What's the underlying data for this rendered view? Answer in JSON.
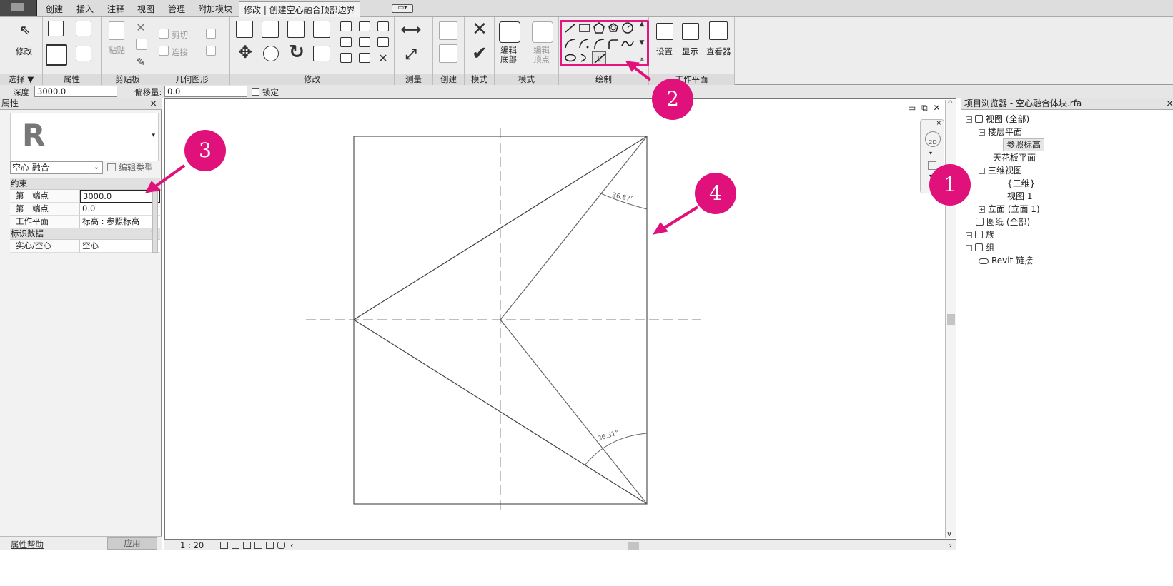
{
  "menu": {
    "tabs": [
      "创建",
      "插入",
      "注释",
      "视图",
      "管理",
      "附加模块"
    ],
    "active_tab": "修改 | 创建空心融合顶部边界"
  },
  "ribbon": {
    "select": {
      "tool": "修改",
      "panel": "选择 ▼"
    },
    "properties_panel": "属性",
    "clipboard": {
      "paste": "粘贴",
      "panel": "剪贴板"
    },
    "geometry": {
      "cut": "剪切",
      "join": "连接",
      "panel": "几何图形"
    },
    "modify": {
      "panel": "修改"
    },
    "measure": {
      "panel": "测量"
    },
    "create": {
      "panel": "创建"
    },
    "mode": {
      "panel": "模式"
    },
    "mode2": {
      "edit_bottom": "编辑底部",
      "edit_vertex": "编辑顶点",
      "panel": "模式"
    },
    "draw": {
      "panel": "绘制"
    },
    "workplane": {
      "set": "设置",
      "show": "显示",
      "viewer": "查看器",
      "panel": "工作平面"
    }
  },
  "options": {
    "depth_label": "深度",
    "depth_value": "3000.0",
    "offset_label": "偏移量:",
    "offset_value": "0.0",
    "lock_label": "锁定"
  },
  "properties": {
    "title": "属性",
    "type": "空心 融合",
    "edit_type": "编辑类型",
    "constraints": "约束",
    "second_end_label": "第二端点",
    "second_end_value": "3000.0",
    "first_end_label": "第一端点",
    "first_end_value": "0.0",
    "workplane_label": "工作平面",
    "workplane_value": "标高 : 参照标高",
    "identity": "标识数据",
    "solid_void_label": "实心/空心",
    "solid_void_value": "空心",
    "help": "属性帮助",
    "apply": "应用"
  },
  "canvas": {
    "angle_top": "36.87°",
    "angle_bottom": "36.31°",
    "scale": "1 : 20"
  },
  "browser": {
    "title": "项目浏览器 - 空心融合体块.rfa",
    "views": "视图 (全部)",
    "floor_plans": "楼层平面",
    "ref_level": "参照标高",
    "ceiling": "天花板平面",
    "three_d": "三维视图",
    "three_d_item": "{三维}",
    "view1": "视图 1",
    "elevation": "立面 (立面 1)",
    "sheets": "图纸 (全部)",
    "families": "族",
    "groups": "组",
    "links": "Revit 链接"
  },
  "callouts": [
    "1",
    "2",
    "3",
    "4"
  ],
  "colors": {
    "accent": "#e0117b"
  }
}
